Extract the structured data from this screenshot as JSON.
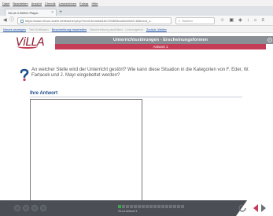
{
  "browser": {
    "menu": [
      "Datei",
      "Bearbeiten",
      "Ansicht",
      "Chronik",
      "Lesezeichen",
      "Extras",
      "Hilfe"
    ],
    "tab_title": "ViLLA 3.0/MHJ Player",
    "url": "https://www.nit.uni-koeln.de/teacher.php/?mod=browse&id=29469&cut&mdvid=18&mod_c...",
    "search_placeholder": "Suchen",
    "bookmarks": [
      {
        "label": "Neues anzeigen",
        "dim": false
      },
      {
        "label": "Ted Hoffmann",
        "dim": true
      },
      {
        "label": "Beschreibung bearbeiten",
        "dim": false
      },
      {
        "label": "Beschreibung ausfüllen - Lernangebot",
        "dim": true
      },
      {
        "label": "Zurück: Weiter",
        "dim": false
      }
    ]
  },
  "app": {
    "logo_text": "ViLLA",
    "title": "Unterrichtsstörungen - Erscheinungsformen",
    "subtitle": "Antwort 1",
    "question": "An welcher Stelle wird der Unterricht gestört? Wie kann diese Situation in die Kategorien von F. Eder, W. Fartacek und J. Mayr eingebettet werden?",
    "answer_label": "Ihre Antwort",
    "answer_value": "",
    "submit_label": "weiter"
  },
  "footer": {
    "progress_total": 17,
    "progress_done": 1,
    "progress_label": "ViLLA Antwort 1"
  },
  "colors": {
    "brand": "#8a1a2e",
    "accent": "#c43c55",
    "title_bg": "#8a8f95",
    "link_blue": "#1f4e8c",
    "button_blue": "#1d4f91",
    "progress_done": "#3aa84b"
  }
}
